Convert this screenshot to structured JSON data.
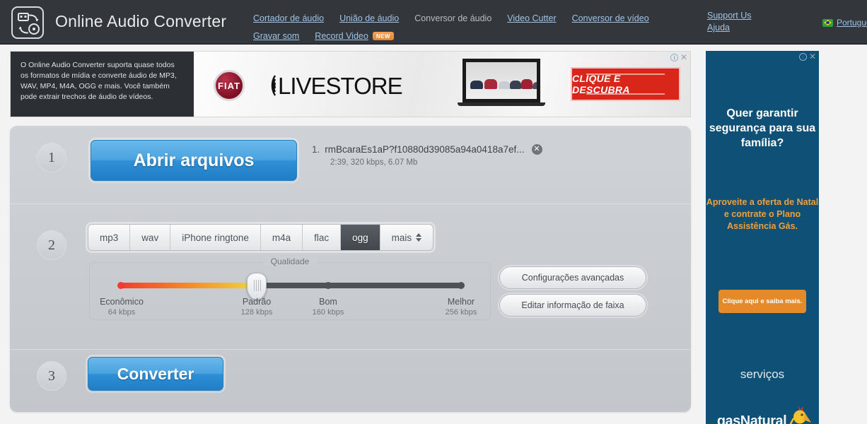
{
  "header": {
    "brand": "Online Audio Converter",
    "logo_icon": "audio-convert-icon",
    "nav_row1": [
      {
        "label": "Cortador de áudio",
        "link": true
      },
      {
        "label": "União de áudio",
        "link": true
      },
      {
        "label": "Conversor de áudio",
        "link": false
      },
      {
        "label": "Video Cutter",
        "link": true
      },
      {
        "label": "Conversor de vídeo",
        "link": true
      }
    ],
    "nav_row2": [
      {
        "label": "Gravar som",
        "link": true,
        "badge": ""
      },
      {
        "label": "Record Video",
        "link": true,
        "badge": "NEW"
      }
    ],
    "support": "Support Us",
    "help": "Ajuda",
    "language": "Português",
    "flag_icon": "brazil-flag-icon",
    "bg_color": "#33363b"
  },
  "top_ad": {
    "promo_text": "O Online Audio Converter suporta quase todos os formatos de mídia e converte áudio de MP3, WAV, MP4, M4A, OGG e mais. Você também pode extrair trechos de áudio de vídeos.",
    "brand_mark": "FIAT",
    "headline_bold": "LIVE",
    "headline_light": "STORE",
    "cta_label": "CLIQUE E DESCUBRA",
    "cta_color": "#d8261b",
    "info_icon": "ad-info-icon",
    "close_icon": "ad-close-icon"
  },
  "steps": {
    "one": {
      "number": "1",
      "open_files_label": "Abrir arquivos",
      "file": {
        "index": "1.",
        "name": "rmBcaraEs1aP?f10880d39085a94a0418a7ef...",
        "meta": "2:39, 320 kbps, 6.07 Mb",
        "remove_icon": "remove-file-icon"
      }
    },
    "two": {
      "number": "2",
      "formats": [
        {
          "label": "mp3",
          "active": false
        },
        {
          "label": "wav",
          "active": false
        },
        {
          "label": "iPhone ringtone",
          "active": false
        },
        {
          "label": "m4a",
          "active": false
        },
        {
          "label": "flac",
          "active": false
        },
        {
          "label": "ogg",
          "active": true
        }
      ],
      "more_label": "mais",
      "more_icon": "chevron-up-down-icon",
      "quality_title": "Qualidade",
      "quality_levels": [
        {
          "name": "Econômico",
          "kbps": "64 kbps"
        },
        {
          "name": "Padrão",
          "kbps": "128 kbps"
        },
        {
          "name": "Bom",
          "kbps": "160 kbps"
        },
        {
          "name": "Melhor",
          "kbps": "256 kbps"
        }
      ],
      "selected_quality": "Padrão",
      "advanced_label": "Configurações avançadas",
      "edit_tag_label": "Editar informação de faixa"
    },
    "three": {
      "number": "3",
      "convert_label": "Converter"
    }
  },
  "side_ad": {
    "headline": "Quer garantir segurança para sua família?",
    "subtext": "Aproveite a oferta de Natal e contrate o Plano Assistência Gás.",
    "button_label": "Clique aqui e saiba mais.",
    "services_label": "serviços",
    "brand": "gasNatural",
    "bg_color": "#0f5076",
    "button_color": "#e58a2b",
    "info_icon": "ad-info-icon",
    "close_icon": "ad-close-icon"
  }
}
